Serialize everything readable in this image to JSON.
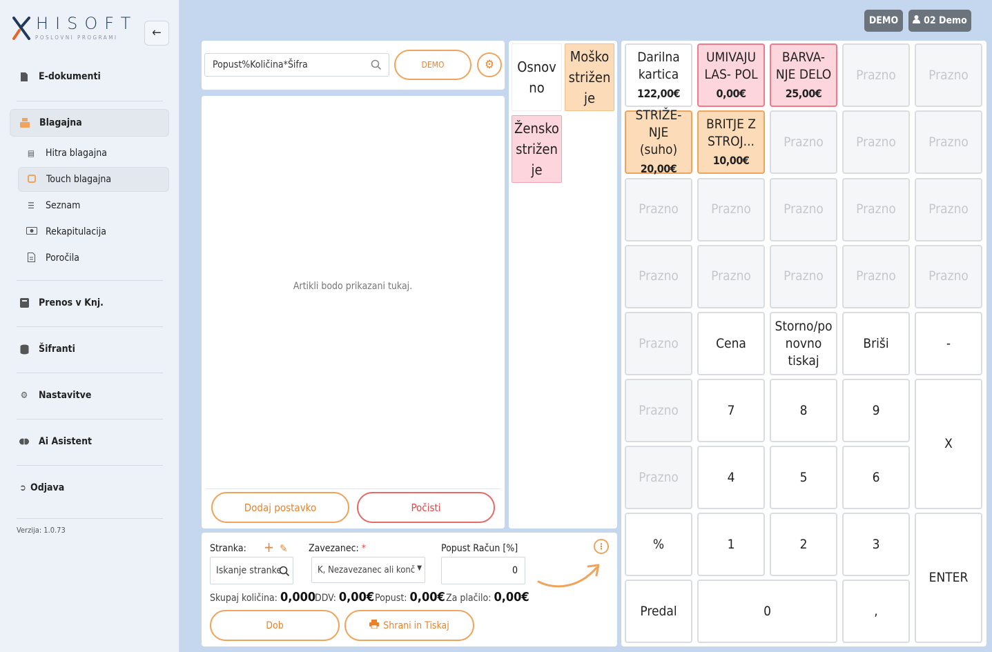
{
  "brand": {
    "name": "HISOFT",
    "tagline": "POSLOVNI PROGRAMI"
  },
  "nav": {
    "edoc": "E-dokumenti",
    "blagajna": "Blagajna",
    "sub": [
      "Hitra blagajna",
      "Touch blagajna",
      "Seznam",
      "Rekapitulacija",
      "Poročila"
    ],
    "prenos": "Prenos v Knj.",
    "sifranti": "Šifranti",
    "nastavitve": "Nastavitve",
    "ai": "Ai Asistent",
    "odjava": "Odjava",
    "version": "Verzija: 1.0.73"
  },
  "top": {
    "demo": "DEMO",
    "user": "02 Demo"
  },
  "order": {
    "search_placeholder": "Popust%Količina*Šifra",
    "mode_btn": "DEMO",
    "empty": "Artikli bodo prikazani tukaj.",
    "add_btn": "Dodaj postavko",
    "clear_btn": "Počisti"
  },
  "categories": {
    "osnovno": "Osnov no",
    "mosko": "Moško strižen je",
    "zensko": "Žensko strižen je"
  },
  "tiles": [
    {
      "label": "Darilna kartica",
      "price": "122,00€",
      "style": "white"
    },
    {
      "label": "UMIVAJU LAS- POL",
      "price": "0,00€",
      "style": "pink"
    },
    {
      "label": "BARVA- NJE DELO",
      "price": "25,00€",
      "style": "pink"
    },
    {
      "label": "Prazno",
      "style": "blank"
    },
    {
      "label": "Prazno",
      "style": "blank"
    },
    {
      "label": "STRIŽE- NJE (suho)",
      "price": "20,00€",
      "style": "orange"
    },
    {
      "label": "BRITJE Z STROJ...",
      "price": "10,00€",
      "style": "orange"
    },
    {
      "label": "Prazno",
      "style": "blank"
    },
    {
      "label": "Prazno",
      "style": "blank"
    },
    {
      "label": "Prazno",
      "style": "blank"
    },
    {
      "label": "Prazno",
      "style": "blank"
    },
    {
      "label": "Prazno",
      "style": "blank"
    },
    {
      "label": "Prazno",
      "style": "blank"
    },
    {
      "label": "Prazno",
      "style": "blank"
    },
    {
      "label": "Prazno",
      "style": "blank"
    },
    {
      "label": "Prazno",
      "style": "blank"
    },
    {
      "label": "Prazno",
      "style": "blank"
    },
    {
      "label": "Prazno",
      "style": "blank"
    },
    {
      "label": "Prazno",
      "style": "blank"
    },
    {
      "label": "Prazno",
      "style": "blank"
    }
  ],
  "keypad": {
    "blank": "Prazno",
    "cena": "Cena",
    "storno": "Storno/po novno tiskaj",
    "brisi": "Briši",
    "minus": "-",
    "k7": "7",
    "k8": "8",
    "k9": "9",
    "x": "X",
    "k4": "4",
    "k5": "5",
    "k6": "6",
    "pct": "%",
    "k1": "1",
    "k2": "2",
    "k3": "3",
    "enter": "ENTER",
    "predal": "Predal",
    "k0": "0",
    "comma": ","
  },
  "bottom": {
    "stranka_label": "Stranka:",
    "stranka_placeholder": "Iskanje stranke",
    "zavezanec_label": "Zavezanec:",
    "zavezanec_star": "*",
    "zavezanec_value": "K, Nezavezanec ali konč",
    "popust_label": "Popust Račun [%]",
    "popust_value": "0",
    "skupaj_label": "Skupaj količina:",
    "skupaj_value": "0,000",
    "ddv_label": "DDV:",
    "ddv_value": "0,00€",
    "popust2_label": "Popust:",
    "popust2_value": "0,00€",
    "zaplacilo_label": "Za plačilo:",
    "zaplacilo_value": "0,00€",
    "dob_btn": "Dob",
    "save_btn": "Shrani in Tiskaj"
  },
  "colors": {
    "accent": "#f0a45b",
    "danger": "#e76a6a",
    "pink": "#fdd5dc",
    "orange": "#fcdcb8"
  }
}
